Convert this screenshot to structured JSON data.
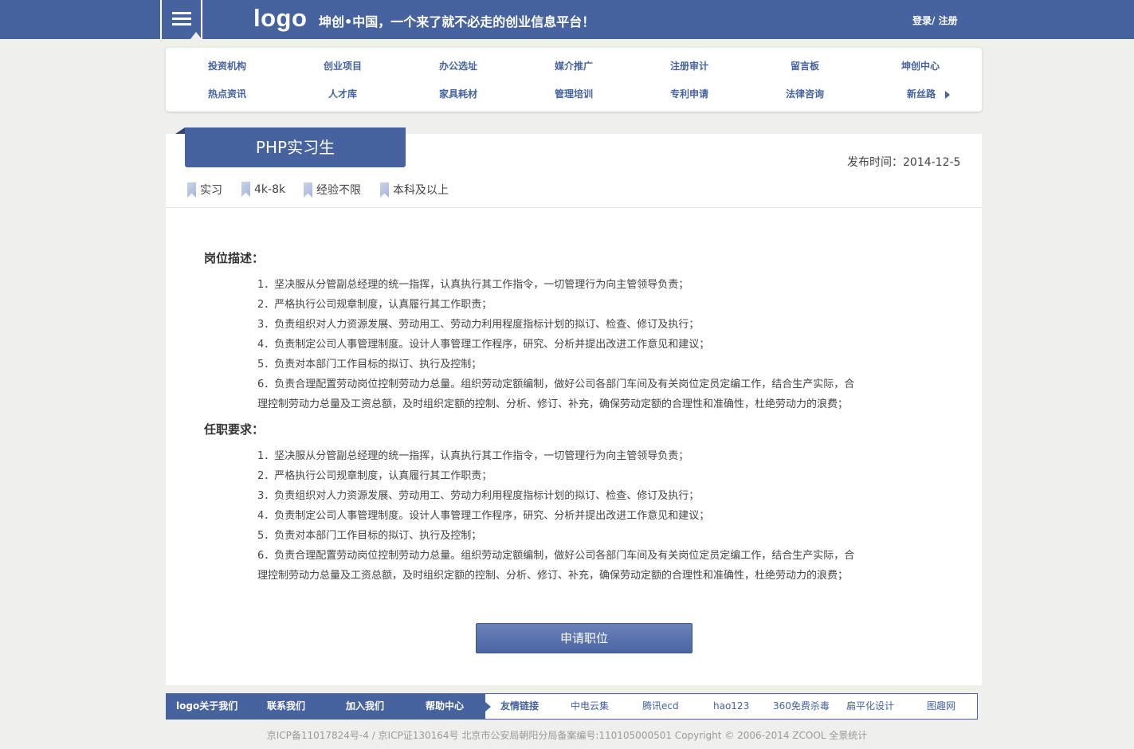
{
  "header": {
    "logo": "logo",
    "slogan": "坤创•中国，一个来了就不必走的创业信息平台！",
    "login": "登录/",
    "register": " 注册"
  },
  "nav": {
    "row1": [
      "投资机构",
      "创业项目",
      "办公选址",
      "媒介推广",
      "注册审计",
      "留言板",
      "坤创中心"
    ],
    "row2": [
      "热点资讯",
      "人才库",
      "家具耗材",
      "管理培训",
      "专利申请",
      "法律咨询",
      "新丝路"
    ]
  },
  "job": {
    "title": "PHP实习生",
    "publish_time": "发布时间：2014-12-5",
    "tags": [
      "实习",
      "4k-8k",
      "经验不限",
      "本科及以上"
    ]
  },
  "description": {
    "title": "岗位描述：",
    "lines": [
      "1．坚决服从分管副总经理的统一指挥，认真执行其工作指令，一切管理行为向主管领导负责；",
      "2．严格执行公司规章制度，认真履行其工作职责；",
      "3．负责组织对人力资源发展、劳动用工、劳动力利用程度指标计划的拟订、检查、修订及执行；",
      "4．负责制定公司人事管理制度。设计人事管理工作程序，研究、分析并提出改进工作意见和建议；",
      "5．负责对本部门工作目标的拟订、执行及控制；",
      "6．负责合理配置劳动岗位控制劳动力总量。组织劳动定额编制，做好公司各部门车间及有关岗位定员定编工作，结合生产实际，合",
      "理控制劳动力总量及工资总额，及时组织定额的控制、分析、修订、补充，确保劳动定额的合理性和准确性，杜绝劳动力的浪费；"
    ]
  },
  "requirements": {
    "title": "任职要求：",
    "lines": [
      "1．坚决服从分管副总经理的统一指挥，认真执行其工作指令，一切管理行为向主管领导负责；",
      "2．严格执行公司规章制度，认真履行其工作职责；",
      "3．负责组织对人力资源发展、劳动用工、劳动力利用程度指标计划的拟订、检查、修订及执行；",
      "4．负责制定公司人事管理制度。设计人事管理工作程序，研究、分析并提出改进工作意见和建议；",
      "5．负责对本部门工作目标的拟订、执行及控制；",
      "6．负责合理配置劳动岗位控制劳动力总量。组织劳动定额编制，做好公司各部门车间及有关岗位定员定编工作，结合生产实际，合",
      "理控制劳动力总量及工资总额，及时组织定额的控制、分析、修订、补充，确保劳动定额的合理性和准确性，杜绝劳动力的浪费；"
    ]
  },
  "apply_label": "申请职位",
  "footer": {
    "links": [
      "logo关于我们",
      "联系我们",
      "加入我们",
      "帮助中心"
    ],
    "friend_title": "友情链接",
    "friend_links": [
      "中电云集",
      "腾讯ecd",
      "hao123",
      "360免费杀毒",
      "扁平化设计",
      "图趣网"
    ],
    "copyright": "京ICP备11017824号-4 / 京ICP证130164号 北京市公安局朝阳分局备案编号:110105000501 Copyright © 2006-2014 ZCOOL 全景统计"
  },
  "colors": {
    "brand": "#46639f",
    "background": "#efefec"
  }
}
